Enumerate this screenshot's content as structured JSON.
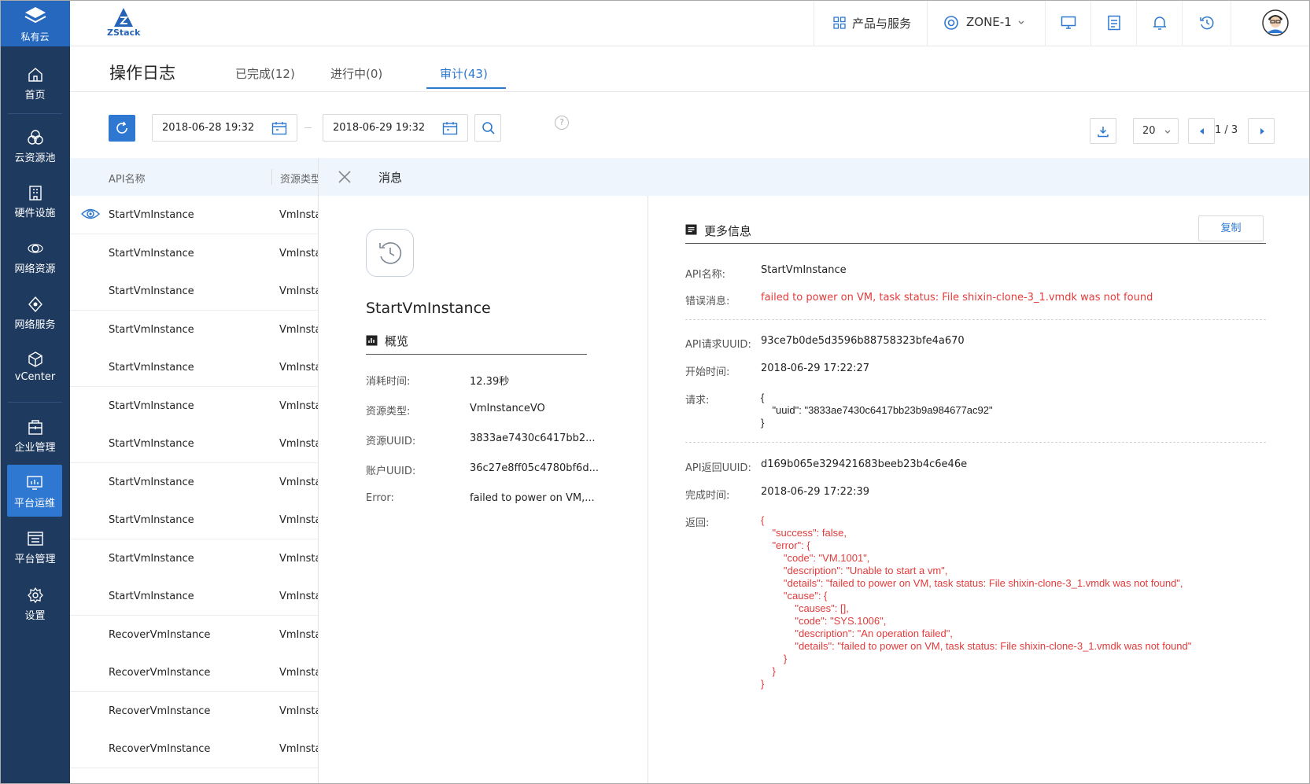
{
  "sidebar": {
    "brand_label": "私有云",
    "brand_icon": "layers-icon",
    "items": [
      {
        "label": "首页",
        "icon": "home-icon"
      },
      {
        "label": "云资源池",
        "icon": "cloud-pool-icon"
      },
      {
        "label": "硬件设施",
        "icon": "building-icon"
      },
      {
        "label": "网络资源",
        "icon": "network-icon"
      },
      {
        "label": "网络服务",
        "icon": "network-service-icon"
      },
      {
        "label": "vCenter",
        "icon": "cube-icon"
      },
      {
        "label": "企业管理",
        "icon": "enterprise-icon"
      },
      {
        "label": "平台运维",
        "icon": "monitor-chart-icon"
      },
      {
        "label": "平台管理",
        "icon": "list-panel-icon"
      },
      {
        "label": "设置",
        "icon": "gear-icon"
      }
    ],
    "active_index": 7
  },
  "topbar": {
    "logo_text": "ZStack",
    "products_label": "产品与服务",
    "zone_label": "ZONE-1",
    "icons": [
      "desktop-icon",
      "document-icon",
      "bell-icon",
      "history-icon",
      "avatar"
    ]
  },
  "page": {
    "title": "操作日志",
    "tabs": [
      "已完成(12)",
      "进行中(0)",
      "审计(43)"
    ],
    "active_tab": 2
  },
  "toolbar": {
    "start_date": "2018-06-28 19:32",
    "end_date": "2018-06-29 19:32",
    "help": "?",
    "page_size": "20",
    "page_indicator": "1 / 3"
  },
  "table": {
    "headers": [
      "API名称",
      "资源类型"
    ],
    "rows": [
      {
        "api": "StartVmInstance",
        "type": "VmInstanceVO"
      },
      {
        "api": "StartVmInstance",
        "type": "VmInstanceVO"
      },
      {
        "api": "StartVmInstance",
        "type": "VmInstanceVO"
      },
      {
        "api": "StartVmInstance",
        "type": "VmInstanceVO"
      },
      {
        "api": "StartVmInstance",
        "type": "VmInstanceVO"
      },
      {
        "api": "StartVmInstance",
        "type": "VmInstanceVO"
      },
      {
        "api": "StartVmInstance",
        "type": "VmInstanceVO"
      },
      {
        "api": "StartVmInstance",
        "type": "VmInstanceVO"
      },
      {
        "api": "StartVmInstance",
        "type": "VmInstanceVO"
      },
      {
        "api": "StartVmInstance",
        "type": "VmInstanceVO"
      },
      {
        "api": "StartVmInstance",
        "type": "VmInstanceVO"
      },
      {
        "api": "RecoverVmInstance",
        "type": "VmInstanceVO"
      },
      {
        "api": "RecoverVmInstance",
        "type": "VmInstanceVO"
      },
      {
        "api": "RecoverVmInstance",
        "type": "VmInstanceVO"
      },
      {
        "api": "RecoverVmInstance",
        "type": "VmInstanceVO"
      }
    ]
  },
  "detail": {
    "header_title": "消息",
    "name": "StartVmInstance",
    "overview_title": "概览",
    "overview": [
      {
        "key": "消耗时间:",
        "value": "12.39秒"
      },
      {
        "key": "资源类型:",
        "value": "VmInstanceVO"
      },
      {
        "key": "资源UUID:",
        "value": "3833ae7430c6417bb2..."
      },
      {
        "key": "账户UUID:",
        "value": "36c27e8ff05c4780bf6d..."
      },
      {
        "key": "Error:",
        "value": "failed to power on VM,..."
      }
    ],
    "more_title": "更多信息",
    "copy_label": "复制",
    "api_name_key": "API名称:",
    "api_name": "StartVmInstance",
    "error_key": "错误消息:",
    "error_msg": "failed to power on VM, task status: File shixin-clone-3_1.vmdk was not found",
    "req_uuid_key": "API请求UUID:",
    "req_uuid": "93ce7b0de5d3596b88758323bfe4a670",
    "start_key": "开始时间:",
    "start_time": "2018-06-29 17:22:27",
    "request_key": "请求:",
    "request_body": "{\n    \"uuid\": \"3833ae7430c6417bb23b9a984677ac92\"\n}",
    "ret_uuid_key": "API返回UUID:",
    "ret_uuid": "d169b065e329421683beeb23b4c6e46e",
    "finish_key": "完成时间:",
    "finish_time": "2018-06-29 17:22:39",
    "return_key": "返回:",
    "return_body": "{\n    \"success\": false,\n    \"error\": {\n        \"code\": \"VM.1001\",\n        \"description\": \"Unable to start a vm\",\n        \"details\": \"failed to power on VM, task status: File shixin-clone-3_1.vmdk was not found\",\n        \"cause\": {\n            \"causes\": [],\n            \"code\": \"SYS.1006\",\n            \"description\": \"An operation failed\",\n            \"details\": \"failed to power on VM, task status: File shixin-clone-3_1.vmdk was not found\"\n        }\n    }\n}"
  },
  "colors": {
    "sidebar": "#1f3a5f",
    "brand": "#2568bd",
    "accent": "#2f78d1",
    "error": "#e23b3b",
    "header_bg": "#eef5fd"
  }
}
